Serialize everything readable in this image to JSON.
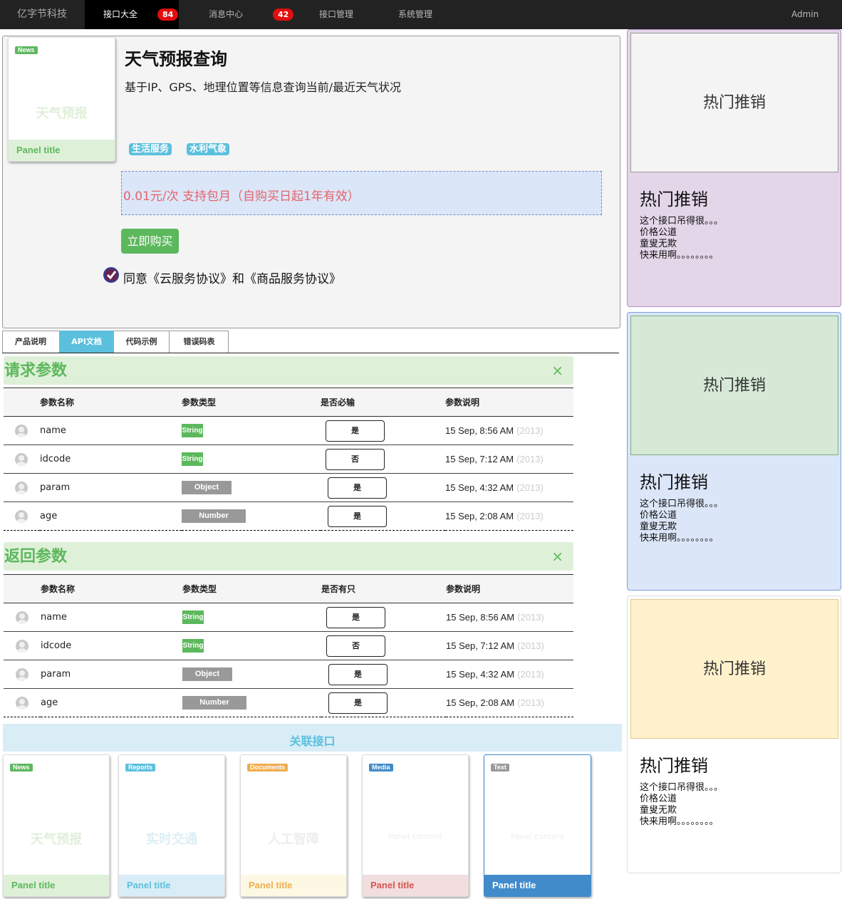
{
  "nav": {
    "brand": "亿字节科技",
    "items": [
      {
        "label": "接口大全",
        "badge": "84"
      },
      {
        "label": "消息中心",
        "badge": "42"
      },
      {
        "label": "接口管理"
      },
      {
        "label": "系统管理"
      }
    ],
    "user": "Admin"
  },
  "product": {
    "thumb": {
      "label": "News",
      "watermark": "天气预报",
      "footer": "Panel title"
    },
    "title": "天气预报查询",
    "desc": "基于IP、GPS、地理位置等信息查询当前/最近天气状况",
    "tags": [
      "生活服务",
      "水利气象"
    ],
    "price": "0.01元/次 支持包月（自购买日起1年有效）",
    "buy": "立即购买",
    "agree": "同意《云服务协议》和《商品服务协议》"
  },
  "tabs": [
    "产品说明",
    "API文档",
    "代码示例",
    "错误码表"
  ],
  "request": {
    "title": "请求参数",
    "close": "×",
    "columns": [
      "参数名称",
      "参数类型",
      "是否必输",
      "参数说明"
    ],
    "rows": [
      {
        "name": "name",
        "type": "String",
        "req": "是",
        "date": "15 Sep, 8:56 AM",
        "year": "(2013)"
      },
      {
        "name": "idcode",
        "type": "String",
        "req": "否",
        "date": "15 Sep, 7:12 AM",
        "year": "(2013)"
      },
      {
        "name": "param",
        "type": "Object",
        "req": "是",
        "date": "15 Sep, 4:32 AM",
        "year": "(2013)"
      },
      {
        "name": "age",
        "type": "Number",
        "req": "是",
        "date": "15 Sep, 2:08 AM",
        "year": "(2013)"
      }
    ]
  },
  "response": {
    "title": "返回参数",
    "close": "×",
    "columns": [
      "参数名称",
      "参数类型",
      "是否有只",
      "参数说明"
    ],
    "rows": [
      {
        "name": "name",
        "type": "String",
        "req": "是",
        "date": "15 Sep, 8:56 AM",
        "year": "(2013)"
      },
      {
        "name": "idcode",
        "type": "String",
        "req": "否",
        "date": "15 Sep, 7:12 AM",
        "year": "(2013)"
      },
      {
        "name": "param",
        "type": "Object",
        "req": "是",
        "date": "15 Sep, 4:32 AM",
        "year": "(2013)"
      },
      {
        "name": "age",
        "type": "Number",
        "req": "是",
        "date": "15 Sep, 2:08 AM",
        "year": "(2013)"
      }
    ]
  },
  "related": {
    "title": "关联接口",
    "cards": [
      {
        "label": "News",
        "watermark": "天气预报",
        "footer": "Panel title",
        "color": "#5cb85c",
        "footBg": "#dff0d8"
      },
      {
        "label": "Reports",
        "watermark": "实时交通",
        "footer": "Panel title",
        "color": "#5bc0de",
        "footBg": "#d9edf7"
      },
      {
        "label": "Documents",
        "watermark": "人工智障",
        "footer": "Panel title",
        "color": "#f0ad4e",
        "footBg": "#fcf8e3"
      },
      {
        "label": "Media",
        "watermark": "Panel content",
        "footer": "Panel title",
        "color": "#d9534f",
        "footBg": "#f2dede"
      },
      {
        "label": "Text",
        "watermark": "Panel content",
        "footer": "Panel title",
        "color": "#428bca",
        "footBg": "#428bca"
      }
    ]
  },
  "sidebar": [
    {
      "img": "热门推销",
      "title": "热门推销",
      "lines": [
        "这个接口吊得很。。。",
        "价格公道",
        "童叟无欺",
        "快来用啊。。。。。。。。"
      ]
    },
    {
      "img": "热门推销",
      "title": "热门推销",
      "lines": [
        "这个接口吊得很。。。",
        "价格公道",
        "童叟无欺",
        "快来用啊。。。。。。。。"
      ]
    },
    {
      "img": "热门推销",
      "title": "热门推销",
      "lines": [
        "这个接口吊得很。。。",
        "价格公道",
        "童叟无欺",
        "快来用啊。。。。。。。。"
      ]
    }
  ]
}
